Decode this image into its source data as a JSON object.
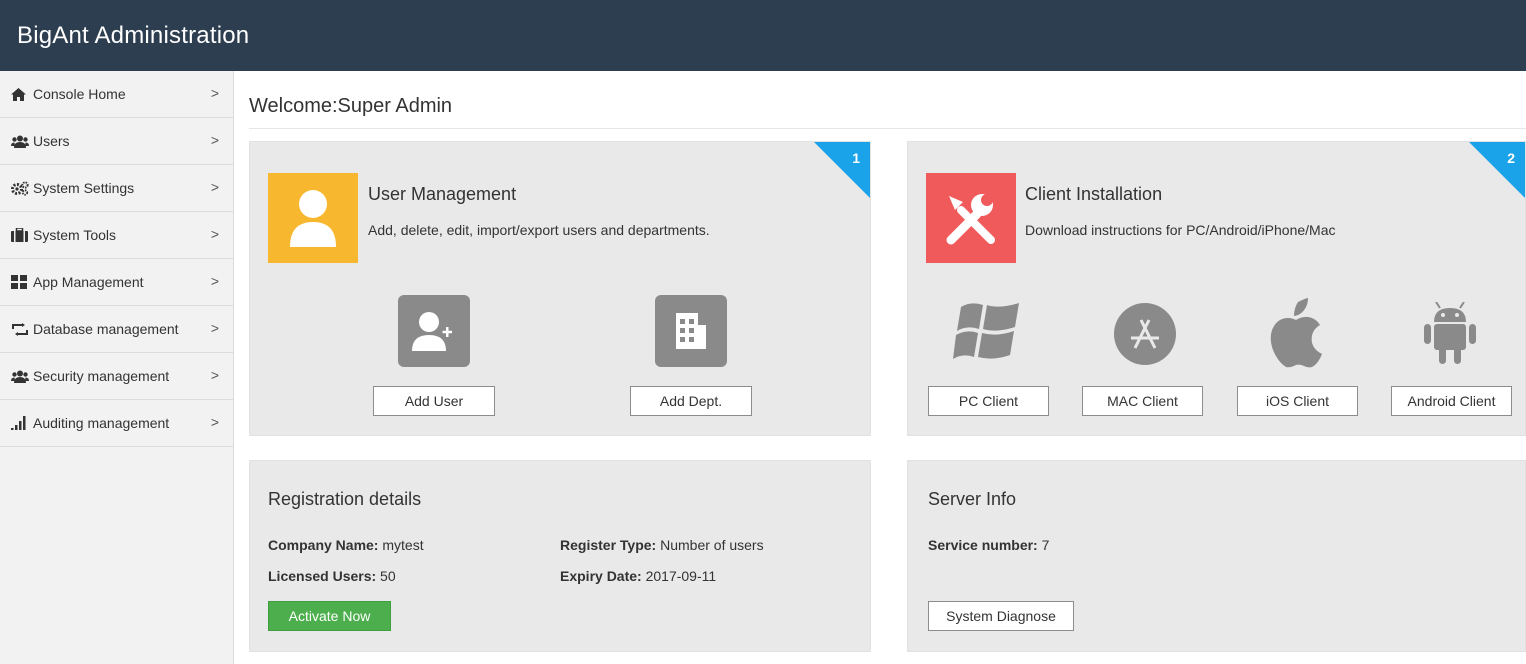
{
  "app": {
    "title": "BigAnt Administration"
  },
  "sidebar": {
    "items": [
      {
        "label": "Console Home",
        "icon": "home-icon"
      },
      {
        "label": "Users",
        "icon": "users-icon"
      },
      {
        "label": "System Settings",
        "icon": "gears-icon"
      },
      {
        "label": "System Tools",
        "icon": "briefcase-icon"
      },
      {
        "label": "App Management",
        "icon": "grid-icon"
      },
      {
        "label": "Database management",
        "icon": "sync-icon"
      },
      {
        "label": "Security management",
        "icon": "users-icon"
      },
      {
        "label": "Auditing management",
        "icon": "signal-bars-icon"
      }
    ],
    "chevron": ">"
  },
  "main": {
    "welcome": "Welcome:Super Admin"
  },
  "user_card": {
    "badge": "1",
    "title": "User Management",
    "desc": "Add, delete, edit, import/export users and departments.",
    "add_user": "Add User",
    "add_dept": "Add Dept.",
    "icon_color": "#f7b82f"
  },
  "client_card": {
    "badge": "2",
    "title": "Client Installation",
    "desc": "Download instructions for PC/Android/iPhone/Mac",
    "pc": "PC Client",
    "mac": "MAC Client",
    "ios": "iOS Client",
    "android": "Android Client",
    "icon_color": "#f05a5b"
  },
  "registration": {
    "title": "Registration details",
    "company_label": "Company Name:",
    "company_value": " mytest",
    "type_label": "Register Type:",
    "type_value": " Number of users",
    "licensed_label": "Licensed Users:",
    "licensed_value": " 50",
    "expiry_label": "Expiry Date:",
    "expiry_value": " 2017-09-11",
    "activate": "Activate Now"
  },
  "server": {
    "title": "Server Info",
    "service_label": "Service number:",
    "service_value": " 7",
    "diagnose": "System Diagnose"
  },
  "colors": {
    "header": "#2d3e50",
    "accent_blue": "#1aa3e8",
    "green": "#4cae4c"
  }
}
